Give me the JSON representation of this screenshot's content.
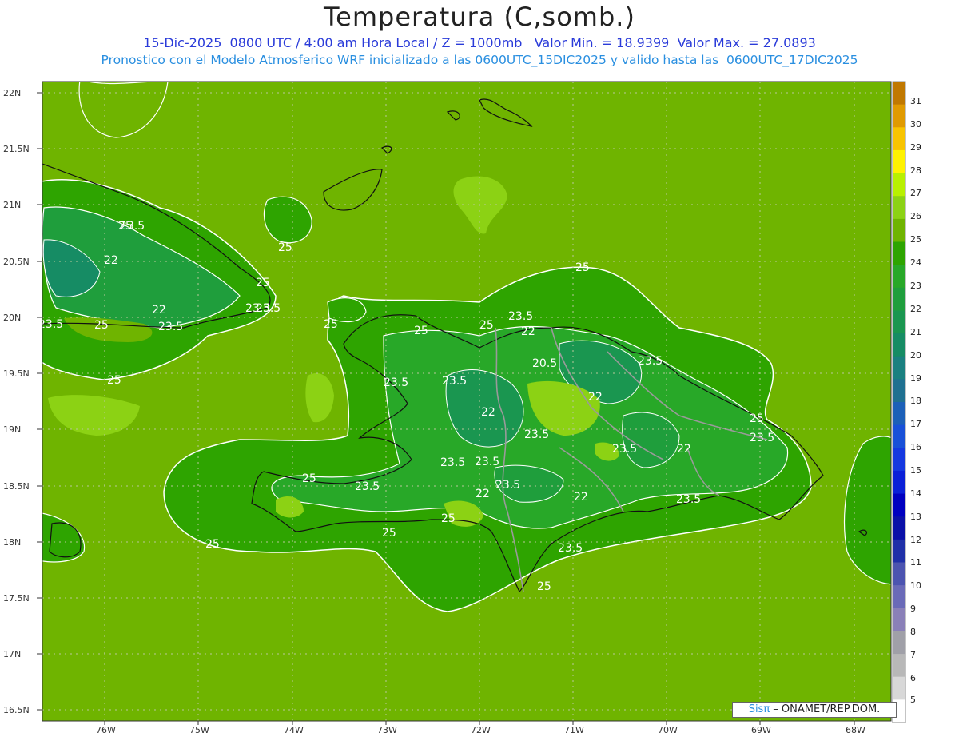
{
  "header": {
    "title": "Temperatura (C,somb.)",
    "subtitle_1": "15-Dic-2025  0800 UTC / 4:00 am Hora Local / Z = 1000mb   Valor Min. = 18.9399  Valor Max. = 27.0893",
    "subtitle_2": "Pronostico con el Modelo Atmosferico WRF inicializado a las 0600UTC_15DIC2025 y valido hasta las  0600UTC_17DIC2025"
  },
  "axes": {
    "lat_labels": [
      "22N",
      "21.5N",
      "21N",
      "20.5N",
      "20N",
      "19.5N",
      "19N",
      "18.5N",
      "18N",
      "17.5N",
      "17N",
      "16.5N"
    ],
    "lon_labels": [
      "76W",
      "75W",
      "74W",
      "73W",
      "72W",
      "71W",
      "70W",
      "69W",
      "68W"
    ]
  },
  "colorbar": {
    "labels": [
      "31",
      "30",
      "29",
      "28",
      "27",
      "26",
      "25",
      "24",
      "23",
      "22",
      "21",
      "20",
      "19",
      "18",
      "17",
      "16",
      "15",
      "14",
      "13",
      "12",
      "11",
      "10",
      "9",
      "8",
      "7",
      "6",
      "5"
    ],
    "colors": [
      "#c07800",
      "#e09a00",
      "#f8c400",
      "#fff200",
      "#b8f000",
      "#8cd214",
      "#6fb400",
      "#2ea400",
      "#28a828",
      "#1f9e3c",
      "#1a9650",
      "#168c64",
      "#1a8080",
      "#1f7090",
      "#1c60b8",
      "#1850d8",
      "#1438e0",
      "#0a20d8",
      "#0000c0",
      "#0a10a8",
      "#2030a8",
      "#4c54b0",
      "#6a6ab8",
      "#8a80b8",
      "#a0a0a8",
      "#b8b8b8",
      "#d8d8d8",
      "#ffffff"
    ]
  },
  "contour_labels": [
    {
      "text": "25"
    },
    {
      "text": "23.5"
    },
    {
      "text": "22"
    },
    {
      "text": "25"
    },
    {
      "text": "23.5"
    },
    {
      "text": "22"
    },
    {
      "text": "23.5"
    },
    {
      "text": "25"
    },
    {
      "text": "23.5"
    },
    {
      "text": "25"
    },
    {
      "text": "25"
    },
    {
      "text": "25"
    },
    {
      "text": "25"
    },
    {
      "text": "23.5"
    },
    {
      "text": "22"
    },
    {
      "text": "25"
    },
    {
      "text": "23.5"
    },
    {
      "text": "23.5"
    },
    {
      "text": "20.5"
    },
    {
      "text": "23.5"
    },
    {
      "text": "22"
    },
    {
      "text": "22"
    },
    {
      "text": "23.5"
    },
    {
      "text": "22"
    },
    {
      "text": "25"
    },
    {
      "text": "23.5"
    },
    {
      "text": "23.5"
    },
    {
      "text": "23.5"
    },
    {
      "text": "23.5"
    },
    {
      "text": "23.5"
    },
    {
      "text": "22"
    },
    {
      "text": "22"
    },
    {
      "text": "23.5"
    },
    {
      "text": "23.5"
    },
    {
      "text": "23.5"
    },
    {
      "text": "25"
    },
    {
      "text": "25"
    },
    {
      "text": "25"
    },
    {
      "text": "25"
    },
    {
      "text": "23.5"
    },
    {
      "text": "25"
    },
    {
      "text": "25"
    }
  ],
  "credit": {
    "brand": "SisPi",
    "brand_glyph": "Sisπ",
    "text": " – ONAMET/REP.DOM."
  }
}
